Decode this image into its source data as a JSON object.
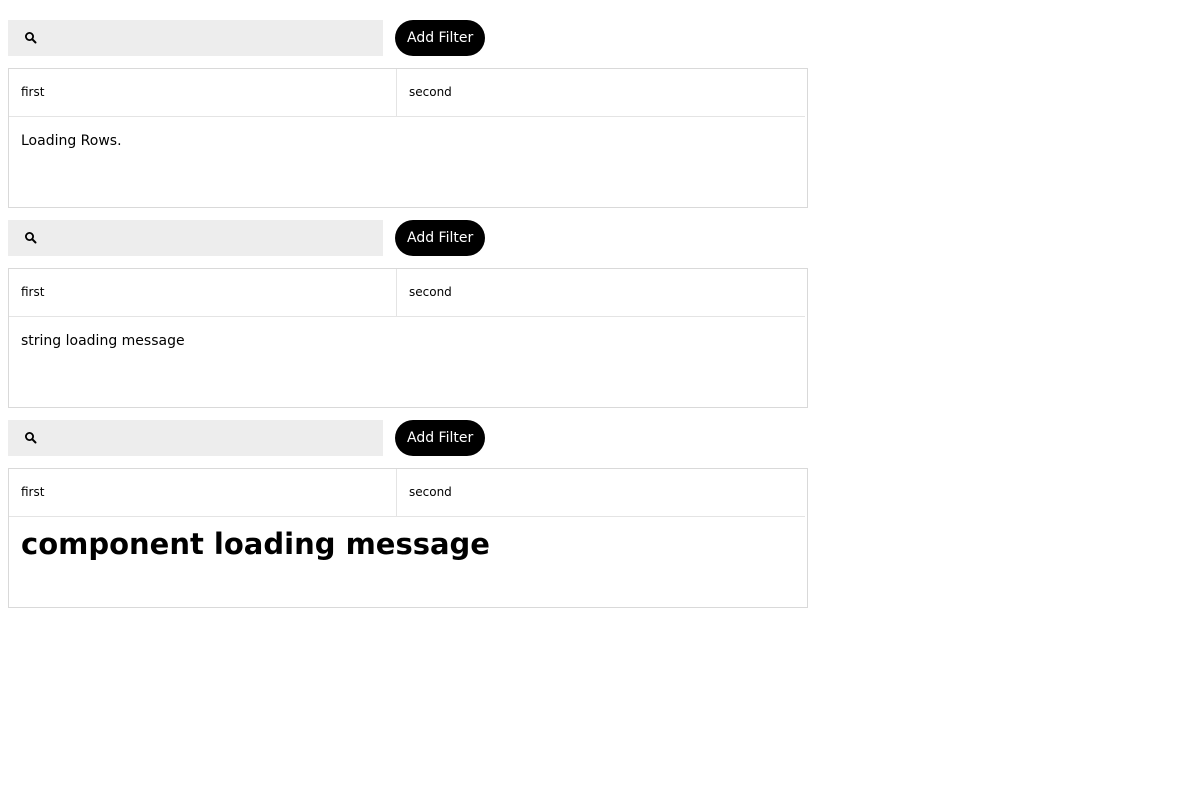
{
  "tables": [
    {
      "search": {
        "value": "",
        "placeholder": ""
      },
      "add_filter_label": "Add Filter",
      "columns": [
        "first",
        "second"
      ],
      "loading_message": "Loading Rows."
    },
    {
      "search": {
        "value": "",
        "placeholder": ""
      },
      "add_filter_label": "Add Filter",
      "columns": [
        "first",
        "second"
      ],
      "loading_message": "string loading message"
    },
    {
      "search": {
        "value": "",
        "placeholder": ""
      },
      "add_filter_label": "Add Filter",
      "columns": [
        "first",
        "second"
      ],
      "loading_message": "component loading message"
    }
  ],
  "icons": {
    "search": "search-icon"
  },
  "colors": {
    "button_bg": "#000000",
    "button_text": "#ffffff",
    "search_bg": "#ededed",
    "border": "#d9d9d9"
  }
}
